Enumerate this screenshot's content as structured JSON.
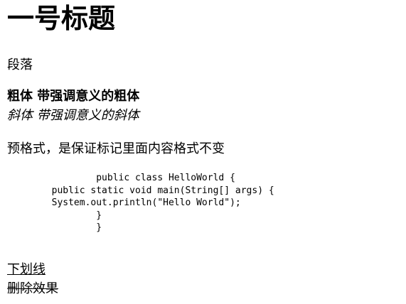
{
  "heading1": "一号标题",
  "paragraph": "段落",
  "bold_text": "粗体 带强调意义的粗体",
  "italic_text": "斜体 带强调意义的斜体",
  "preformatted_label": "预格式，是保证标记里面内容格式不变",
  "code_lines": [
    "                public class HelloWorld {",
    "        public static void main(String[] args) {",
    "        System.out.println(\"Hello World\");",
    "                }",
    "                }"
  ],
  "underline_text": "下划线",
  "strikethrough_text": "删除效果"
}
